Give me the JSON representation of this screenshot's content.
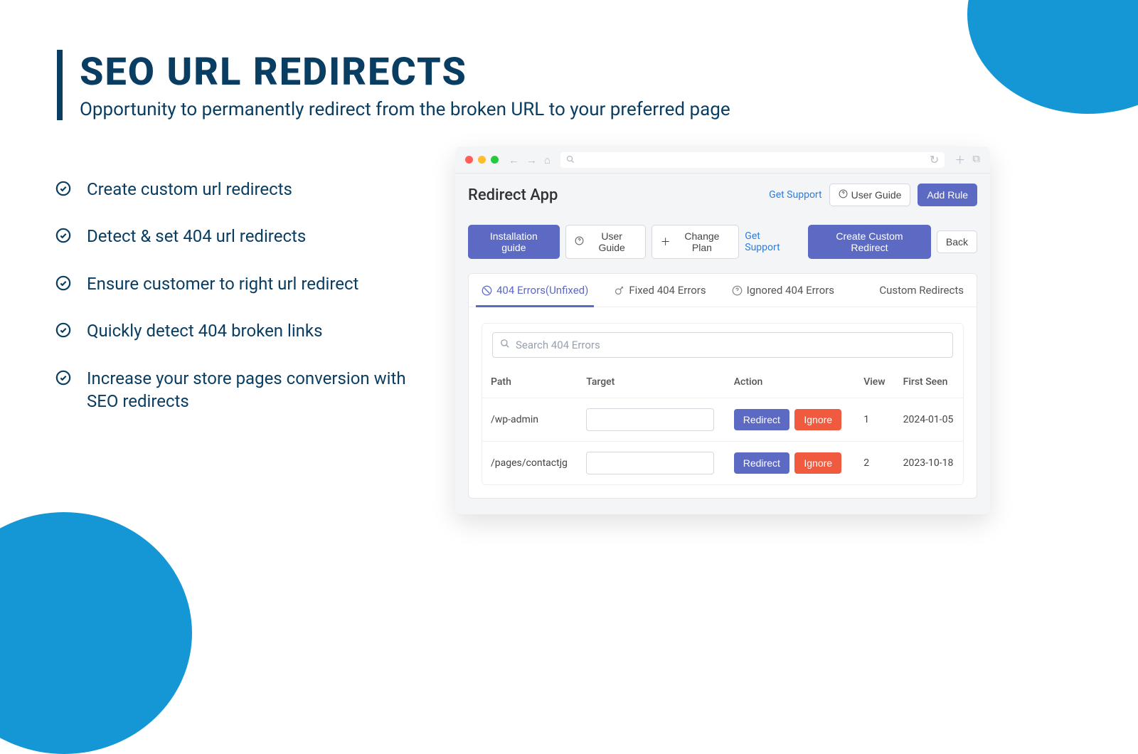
{
  "hero": {
    "title": "SEO URL REDIRECTS",
    "subtitle": "Opportunity to permanently redirect from the broken URL to your preferred page"
  },
  "bullets": [
    "Create custom url redirects",
    "Detect & set 404 url redirects",
    "Ensure customer to right url redirect",
    "Quickly detect 404 broken links",
    "Increase your store pages conversion with SEO redirects"
  ],
  "app": {
    "title": "Redirect App",
    "header_actions": {
      "get_support": "Get Support",
      "user_guide": "User Guide",
      "add_rule": "Add Rule"
    },
    "toolbar": {
      "installation_guide": "Installation guide",
      "user_guide": "User Guide",
      "change_plan": "Change Plan",
      "get_support": "Get Support",
      "create_custom_redirect": "Create Custom Redirect",
      "back": "Back"
    },
    "tabs": [
      "404 Errors(Unfixed)",
      "Fixed 404 Errors",
      "Ignored 404 Errors",
      "Custom Redirects"
    ],
    "search_placeholder": "Search 404 Errors",
    "columns": {
      "path": "Path",
      "target": "Target",
      "action": "Action",
      "view": "View",
      "first_seen": "First Seen"
    },
    "action_labels": {
      "redirect": "Redirect",
      "ignore": "Ignore"
    },
    "rows": [
      {
        "path": "/wp-admin",
        "view": "1",
        "first_seen": "2024-01-05"
      },
      {
        "path": "/pages/contactjg",
        "view": "2",
        "first_seen": "2023-10-18"
      }
    ]
  }
}
